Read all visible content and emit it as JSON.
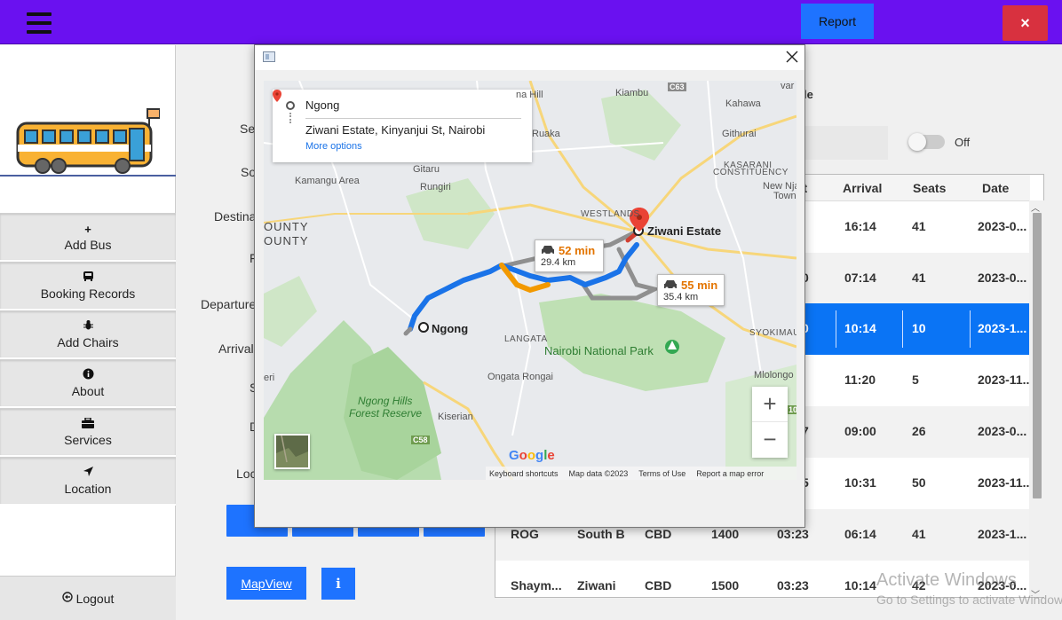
{
  "header": {
    "report_label": "Report",
    "close_label": "×"
  },
  "sidebar": {
    "items": [
      {
        "icon": "plus-icon",
        "glyph": "+",
        "label": "Add Bus"
      },
      {
        "icon": "bus-icon",
        "glyph": "🚌",
        "label": "Booking Records"
      },
      {
        "icon": "bug-icon",
        "glyph": "✱",
        "label": "Add Chairs"
      },
      {
        "icon": "info-icon",
        "glyph": "ℹ",
        "label": "About"
      },
      {
        "icon": "briefcase-icon",
        "glyph": "▣",
        "label": "Services"
      },
      {
        "icon": "location-arrow-icon",
        "glyph": "➤",
        "label": "Location"
      }
    ],
    "logout_label": "Logout",
    "logout_glyph": "⊖"
  },
  "form": {
    "labels": {
      "search": "Sea",
      "source": "So",
      "destination": "Destina",
      "fare": "F",
      "departure": "Departure",
      "arrival": "Arrival",
      "seats": "S",
      "date": "D",
      "location": "Loc"
    },
    "mapview_label": "MapView",
    "info_label": "i",
    "right_label": "le",
    "toggle_label": "Off"
  },
  "table": {
    "headers": [
      "rt",
      "Arrival",
      "Seats",
      "Date"
    ],
    "rows": [
      {
        "c1": "",
        "c2": "",
        "c3": "",
        "c4": "",
        "dep": "",
        "arrival": "16:14",
        "seats": "41",
        "date": "2023-0..."
      },
      {
        "c1": "",
        "c2": "",
        "c3": "",
        "c4": "",
        "dep": "0",
        "arrival": "07:14",
        "seats": "41",
        "date": "2023-0..."
      },
      {
        "c1": "",
        "c2": "",
        "c3": "",
        "c4": "",
        "dep": "0",
        "arrival": "10:14",
        "seats": "10",
        "date": "2023-1..."
      },
      {
        "c1": "",
        "c2": "",
        "c3": "",
        "c4": "",
        "dep": "",
        "arrival": "11:20",
        "seats": "5",
        "date": "2023-11..."
      },
      {
        "c1": "",
        "c2": "",
        "c3": "",
        "c4": "",
        "dep": "7",
        "arrival": "09:00",
        "seats": "26",
        "date": "2023-0..."
      },
      {
        "c1": "",
        "c2": "",
        "c3": "",
        "c4": "",
        "dep": "5",
        "arrival": "10:31",
        "seats": "50",
        "date": "2023-11..."
      },
      {
        "c1": "ROG",
        "c2": "South B",
        "c3": "CBD",
        "c4": "1400",
        "dep": "03:23",
        "arrival": "06:14",
        "seats": "41",
        "date": "2023-1..."
      },
      {
        "c1": "Shaym...",
        "c2": "Ziwani",
        "c3": "CBD",
        "c4": "1500",
        "dep": "03:23",
        "arrival": "10:14",
        "seats": "42",
        "date": "2023-0..."
      }
    ]
  },
  "watermark": {
    "line1": "Activate Windows",
    "line2": "Go to Settings to activate Windows."
  },
  "modal": {
    "close_label": "X",
    "directions": {
      "from": "Ngong",
      "to": "Ziwani Estate, Kinyanjui St, Nairobi",
      "more": "More options"
    },
    "routes": [
      {
        "time": "52 min",
        "distance": "29.4 km"
      },
      {
        "time": "55 min",
        "distance": "35.4 km"
      }
    ],
    "places": {
      "kiambu": "Kiambu",
      "kahawa": "Kahawa",
      "githurai": "Githurai",
      "ruaka": "Ruaka",
      "gitaru": "Gitaru",
      "rungiri": "Rungiri",
      "kamangu": "Kamangu Area",
      "kasarani": "KASARANI",
      "constituency": "CONSTITUENCY",
      "new_nja": "New Nja",
      "town": "Town",
      "westlands": "WESTLANDS",
      "ziwani": "Ziwani Estate",
      "county1": "OUNTY",
      "county2": "OUNTY",
      "ngong": "Ngong",
      "langata": "LANGATA",
      "nairobi_np": "Nairobi National Park",
      "syokimau": "SYOKIMAU",
      "ongata": "Ongata Rongai",
      "mlolongo": "Mlolongo",
      "ngong_hills1": "Ngong Hills",
      "ngong_hills2": "Forest Reserve",
      "kiserian": "Kiserian",
      "eri": "eri",
      "na_hill": "na Hill",
      "var": "var",
      "c63": "C63",
      "c58": "C58",
      "road_10": "10"
    },
    "attribution": [
      "Keyboard shortcuts",
      "Map data ©2023",
      "Terms of Use",
      "Report a map error"
    ],
    "google": "Google",
    "zoom_in": "+",
    "zoom_out": "−"
  }
}
